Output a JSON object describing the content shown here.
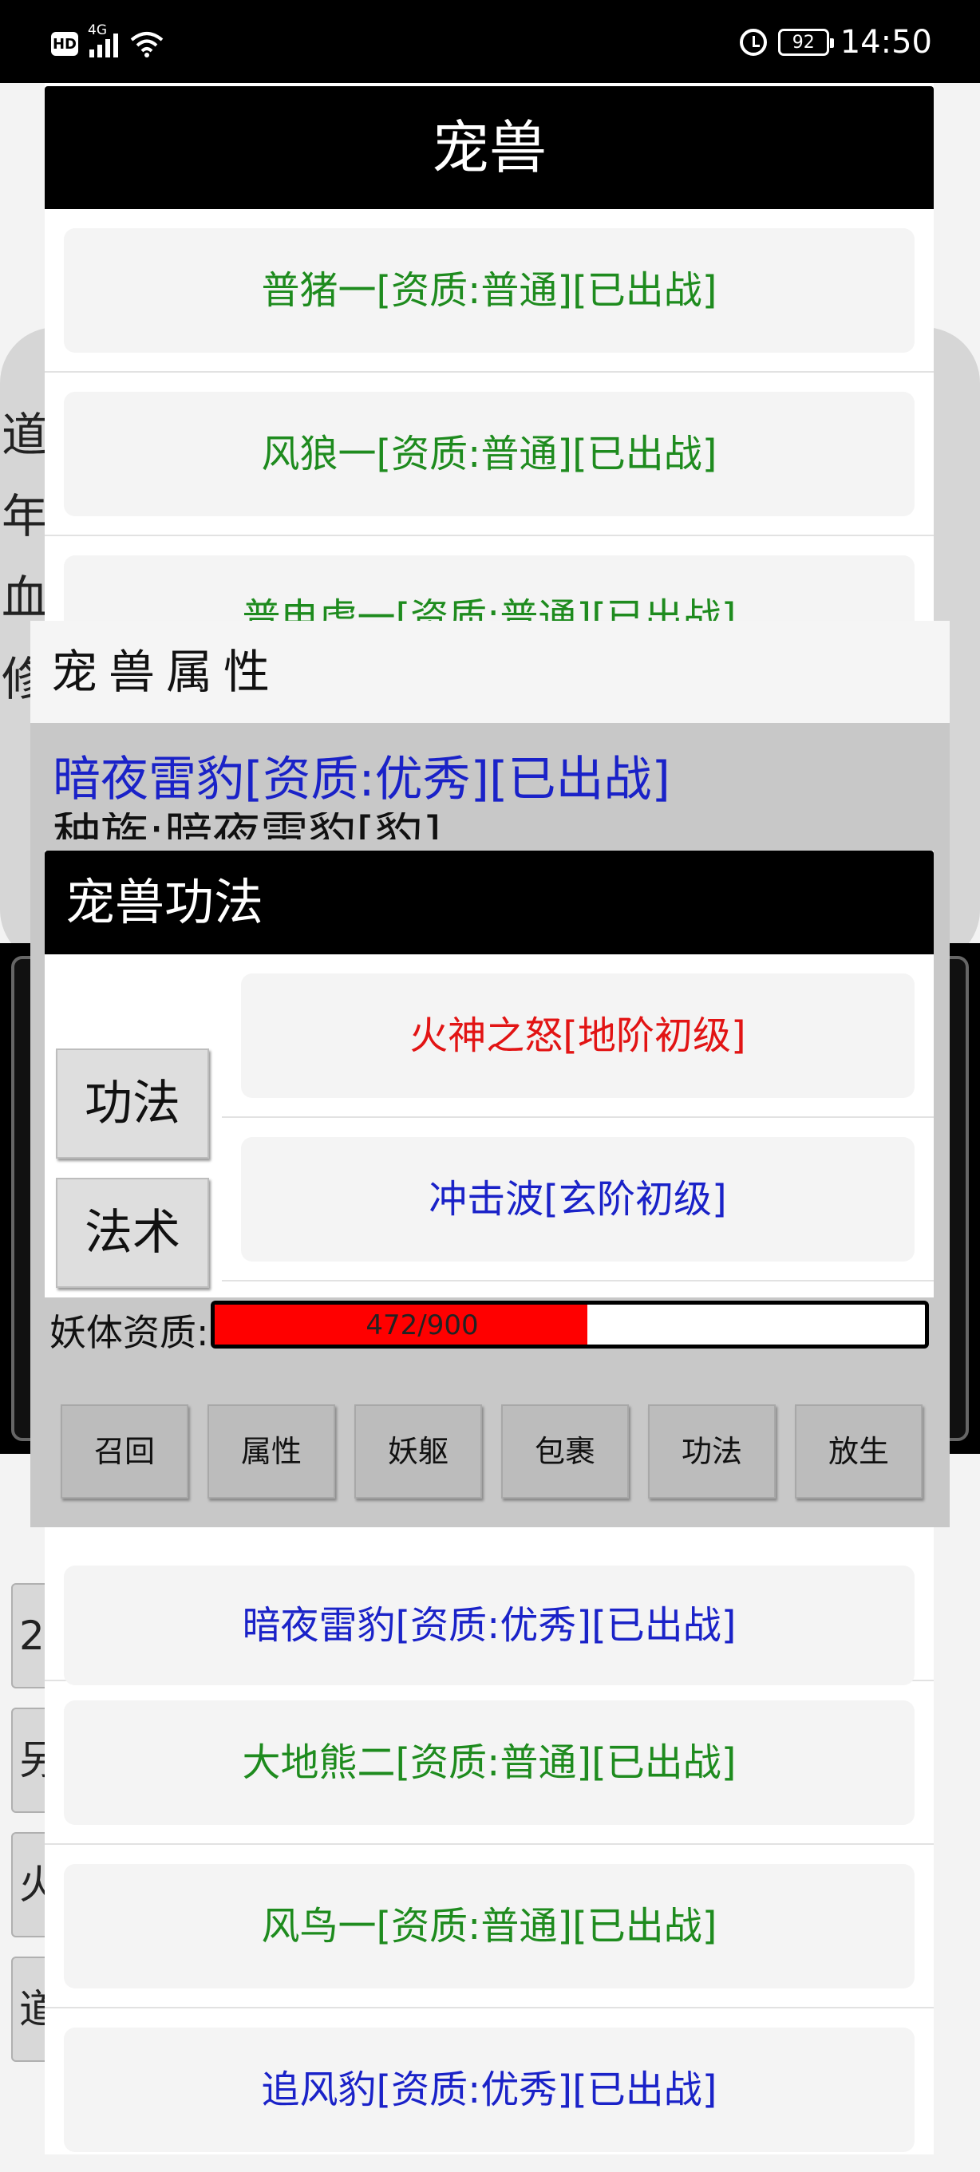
{
  "status_bar": {
    "hd": "HD",
    "network": "4G",
    "battery": "92",
    "time": "14:50"
  },
  "background": {
    "stats": [
      "道",
      "年",
      "血",
      "修"
    ],
    "side_buttons": [
      "2",
      "另",
      "火",
      "道"
    ]
  },
  "pet_list": {
    "title": "宠兽",
    "items": [
      {
        "label": "普猪一[资质:普通][已出战]",
        "color": "green"
      },
      {
        "label": "风狼一[资质:普通][已出战]",
        "color": "green"
      },
      {
        "label": "普电虎一[资质:普通][已出战]",
        "color": "green"
      },
      {
        "label": "暗夜雷豹[资质:优秀][已出战]",
        "color": "blue"
      },
      {
        "label": "大地熊二[资质:普通][已出战]",
        "color": "green"
      },
      {
        "label": "风鸟一[资质:普通][已出战]",
        "color": "green"
      },
      {
        "label": "追风豹[资质:优秀][已出战]",
        "color": "blue"
      }
    ]
  },
  "attributes": {
    "title": "宠兽属性",
    "pet_name": "暗夜雷豹[资质:优秀][已出战]",
    "race": "种族:暗夜雷豹[豹]"
  },
  "skills": {
    "title": "宠兽功法",
    "tabs": [
      "功法",
      "法术"
    ],
    "items": [
      {
        "label": "火神之怒[地阶初级]",
        "color": "red"
      },
      {
        "label": "冲击波[玄阶初级]",
        "color": "blue"
      }
    ]
  },
  "quality": {
    "label": "妖体资质:",
    "text": "472/900",
    "current": 472,
    "max": 900
  },
  "actions": [
    "召回",
    "属性",
    "妖躯",
    "包裹",
    "功法",
    "放生"
  ],
  "colors": {
    "green_text": "#1e8b1e",
    "blue_text": "#1a22c8",
    "red_text": "#e21414",
    "bar_fill": "#ff0000"
  }
}
